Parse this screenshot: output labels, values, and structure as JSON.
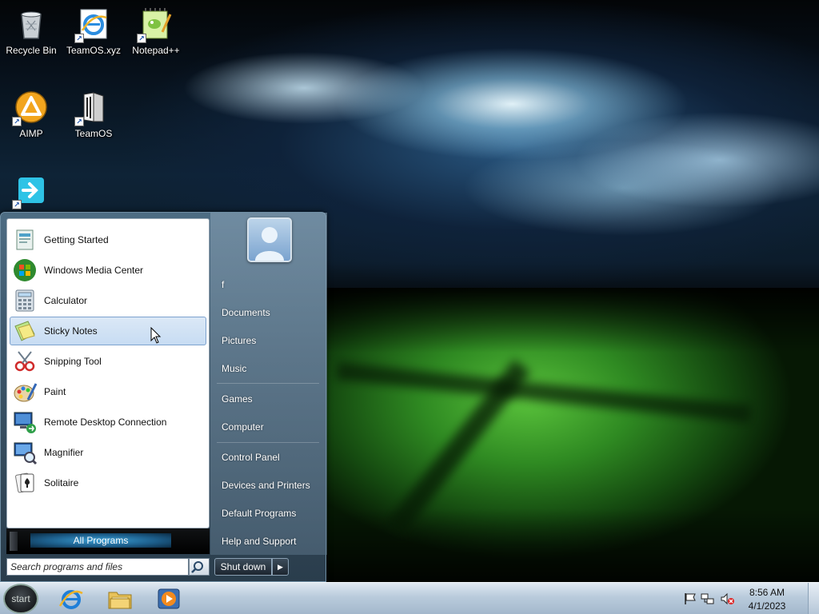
{
  "desktop": {
    "icons": [
      {
        "label": "Recycle Bin",
        "icon": "recycle-bin-icon"
      },
      {
        "label": "TeamOS.xyz",
        "icon": "internet-explorer-icon"
      },
      {
        "label": "Notepad++",
        "icon": "notepad-plus-plus-icon"
      },
      {
        "label": "AIMP",
        "icon": "aimp-icon"
      },
      {
        "label": "TeamOS",
        "icon": "teamos-icon"
      },
      {
        "label": "",
        "icon": "app-shortcut-icon"
      }
    ]
  },
  "start_menu": {
    "programs": [
      {
        "label": "Getting Started",
        "icon": "getting-started-icon"
      },
      {
        "label": "Windows Media Center",
        "icon": "media-center-icon"
      },
      {
        "label": "Calculator",
        "icon": "calculator-icon"
      },
      {
        "label": "Sticky Notes",
        "icon": "sticky-notes-icon",
        "selected": true
      },
      {
        "label": "Snipping Tool",
        "icon": "snipping-tool-icon"
      },
      {
        "label": "Paint",
        "icon": "paint-icon"
      },
      {
        "label": "Remote Desktop Connection",
        "icon": "remote-desktop-icon"
      },
      {
        "label": "Magnifier",
        "icon": "magnifier-icon"
      },
      {
        "label": "Solitaire",
        "icon": "solitaire-icon"
      }
    ],
    "all_programs_label": "All Programs",
    "search_placeholder": "Search programs and files",
    "user_name": "f",
    "right_items": [
      "Documents",
      "Pictures",
      "Music",
      "Games",
      "Computer",
      "Control Panel",
      "Devices and Printers",
      "Default Programs",
      "Help and Support"
    ],
    "shutdown_label": "Shut down"
  },
  "taskbar": {
    "start_label": "start",
    "pinned": [
      "internet-explorer-icon",
      "explorer-icon",
      "media-player-icon"
    ],
    "tray": [
      "action-center-flag-icon",
      "network-icon",
      "volume-muted-icon"
    ],
    "clock": {
      "time": "8:56 AM",
      "date": "4/1/2023"
    }
  },
  "colors": {
    "selection": "#c7dcf3",
    "selection_border": "#7da2ce",
    "taskbar": "#b9cbdc"
  }
}
